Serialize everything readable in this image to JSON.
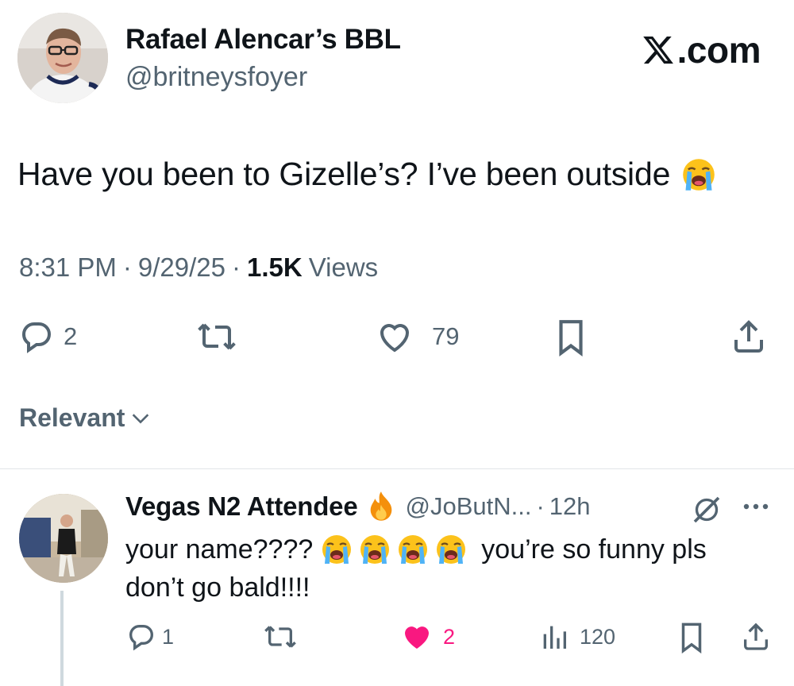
{
  "main_tweet": {
    "display_name": "Rafael Alencar’s BBL",
    "handle": "@britneysfoyer",
    "text": "Have you been to Gizelle’s? I’ve been outside",
    "text_emoji": "loudly-crying-face-icon",
    "time": "8:31 PM",
    "date": "9/29/25",
    "views_count": "1.5K",
    "views_label": "Views",
    "replies": "2",
    "likes": "79"
  },
  "watermark": {
    "text": ".com",
    "logo": "x-logo-icon"
  },
  "sort": {
    "label": "Relevant"
  },
  "reply": {
    "display_name": "Vegas N2 Attendee",
    "badge_emoji": "fire-icon",
    "handle": "@JoButN...",
    "separator": "·",
    "time": "12h",
    "text_line1": "your name????",
    "text_line1_end": "you’re so funny pls",
    "text_line2": "don’t go bald!!!!",
    "emoji_count": 4,
    "replies": "1",
    "likes": "2",
    "views": "120"
  },
  "colors": {
    "text": "#0f1419",
    "secondary": "#536471",
    "like_pink": "#f91880",
    "divider": "#e1e5e8",
    "thread_line": "#cfd9de"
  }
}
